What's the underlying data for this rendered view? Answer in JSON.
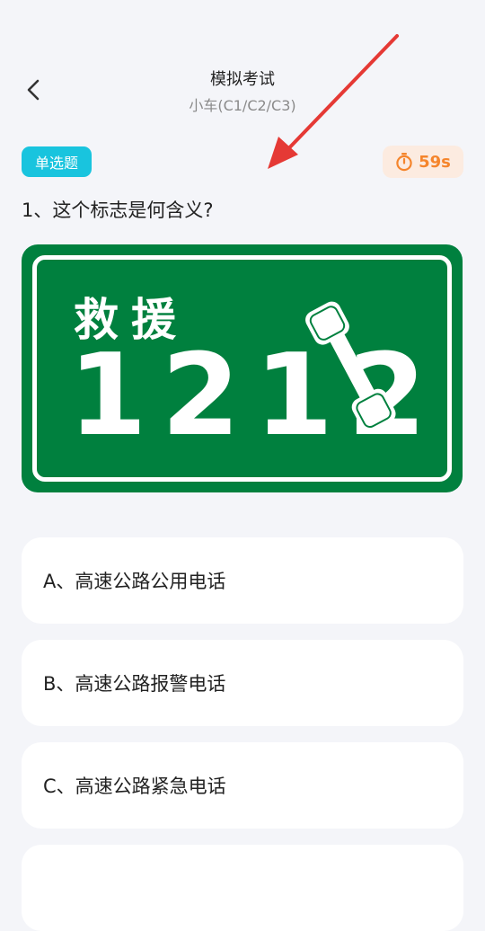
{
  "header": {
    "title": "模拟考试",
    "subtitle": "小车(C1/C2/C3)",
    "back_icon": "chevron-left-icon"
  },
  "question": {
    "type_badge": "单选题",
    "timer": "59s",
    "text": "1、这个标志是何含义?",
    "sign": {
      "text_cn": "救援",
      "number": "1212",
      "bg_color": "#00803e"
    }
  },
  "options": [
    {
      "label": "A、高速公路公用电话"
    },
    {
      "label": "B、高速公路报警电话"
    },
    {
      "label": "C、高速公路紧急电话"
    },
    {
      "label": ""
    }
  ],
  "colors": {
    "accent_badge": "#19c4de",
    "timer_text": "#f5852c",
    "annotation_arrow": "#e53935"
  }
}
